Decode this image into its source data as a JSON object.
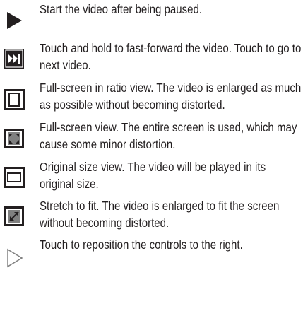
{
  "items": [
    {
      "icon": "play-icon",
      "text": "Start the video after being paused."
    },
    {
      "icon": "fast-forward-next-icon",
      "text": "Touch and hold to fast-forward the video. Touch to go to next video."
    },
    {
      "icon": "fullscreen-ratio-icon",
      "text": "Full-screen in ratio view. The video is enlarged as much as possible without becoming distorted."
    },
    {
      "icon": "fullscreen-icon",
      "text": "Full-screen view. The entire screen is used, which may cause some minor distortion."
    },
    {
      "icon": "original-size-icon",
      "text": "Original size view. The video will be played in its original size."
    },
    {
      "icon": "stretch-to-fit-icon",
      "text": "Stretch to fit. The video is enlarged to fit the screen without becoming distorted."
    },
    {
      "icon": "reposition-controls-icon",
      "text": "Touch to reposition the controls to the right."
    }
  ],
  "colors": {
    "text": "#231f20",
    "icon_dark": "#231f20",
    "icon_gray": "#808080"
  }
}
